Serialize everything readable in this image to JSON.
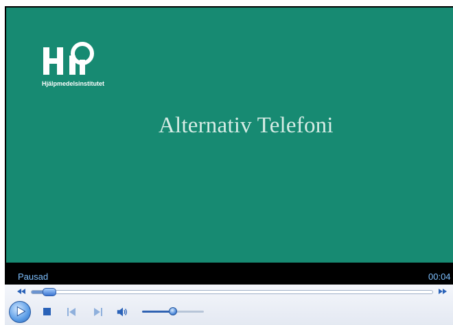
{
  "video": {
    "logo_text": "Hi",
    "logo_caption": "Hjälpmedelsinstitutet",
    "title": "Alternativ Telefoni",
    "background_color": "#178a72"
  },
  "status": {
    "state": "Pausad",
    "time": "00:04"
  },
  "playback": {
    "position_fraction": 0.03,
    "volume_fraction": 0.5
  },
  "icons": {
    "rewind": "rewind-icon",
    "fast_forward": "fast-forward-icon",
    "play": "play-icon",
    "stop": "stop-icon",
    "previous": "previous-icon",
    "next": "next-icon",
    "volume": "speaker-icon"
  },
  "colors": {
    "accent": "#2a62b8",
    "status_text": "#7ec0ff"
  }
}
